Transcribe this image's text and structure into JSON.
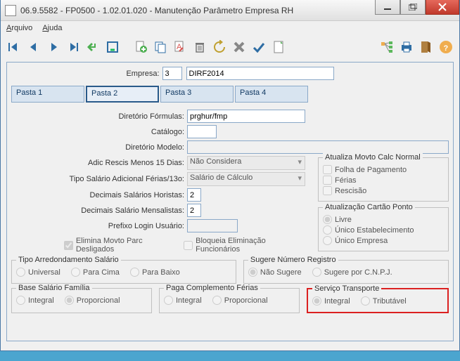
{
  "window": {
    "title": "06.9.5582 - FP0500 - 1.02.01.020 - Manutenção Parâmetro Empresa RH"
  },
  "menu": {
    "arquivo": "Arquivo",
    "ajuda": "Ajuda"
  },
  "header": {
    "empresa_label": "Empresa:",
    "empresa_value": "3",
    "empresa_name": "DIRF2014"
  },
  "tabs": {
    "t1": "Pasta 1",
    "t2": "Pasta 2",
    "t3": "Pasta 3",
    "t4": "Pasta 4"
  },
  "form": {
    "diretorio_formulas_label": "Diretório Fórmulas:",
    "diretorio_formulas_value": "prghur/fmp",
    "catalogo_label": "Catálogo:",
    "catalogo_value": "",
    "diretorio_modelo_label": "Diretório Modelo:",
    "diretorio_modelo_value": "",
    "adic_rescis_label": "Adic Rescis Menos 15 Dias:",
    "adic_rescis_value": "Não Considera",
    "tipo_salario_label": "Tipo Salário Adicional Férias/13o:",
    "tipo_salario_value": "Salário de Cálculo",
    "decimais_horistas_label": "Decimais Salários Horistas:",
    "decimais_horistas_value": "2",
    "decimais_mensalistas_label": "Decimais Salário Mensalistas:",
    "decimais_mensalistas_value": "2",
    "prefixo_label": "Prefixo Login Usuário:",
    "prefixo_value": "",
    "elimina_movto_label": "Elimina Movto Parc Desligados",
    "bloqueia_label": "Bloqueia Eliminação Funcionários"
  },
  "atualiza_movto": {
    "legend": "Atualiza Movto Calc Normal",
    "folha": "Folha de Pagamento",
    "ferias": "Férias",
    "rescisao": "Rescisão"
  },
  "atualiza_cartao": {
    "legend": "Atualização Cartão Ponto",
    "livre": "Livre",
    "unico_estab": "Único Estabelecimento",
    "unico_empresa": "Único Empresa"
  },
  "tipo_arred": {
    "legend": "Tipo Arredondamento Salário",
    "universal": "Universal",
    "para_cima": "Para Cima",
    "para_baixo": "Para Baixo"
  },
  "sugere": {
    "legend": "Sugere Número Registro",
    "nao_sugere": "Não Sugere",
    "sugere_cnpj": "Sugere por C.N.P.J."
  },
  "base_salario": {
    "legend": "Base Salário Família",
    "integral": "Integral",
    "proporcional": "Proporcional"
  },
  "paga_complemento": {
    "legend": "Paga Complemento Férias",
    "integral": "Integral",
    "proporcional": "Proporcional"
  },
  "servico_transporte": {
    "legend": "Serviço Transporte",
    "integral": "Integral",
    "tributavel": "Tributável"
  }
}
